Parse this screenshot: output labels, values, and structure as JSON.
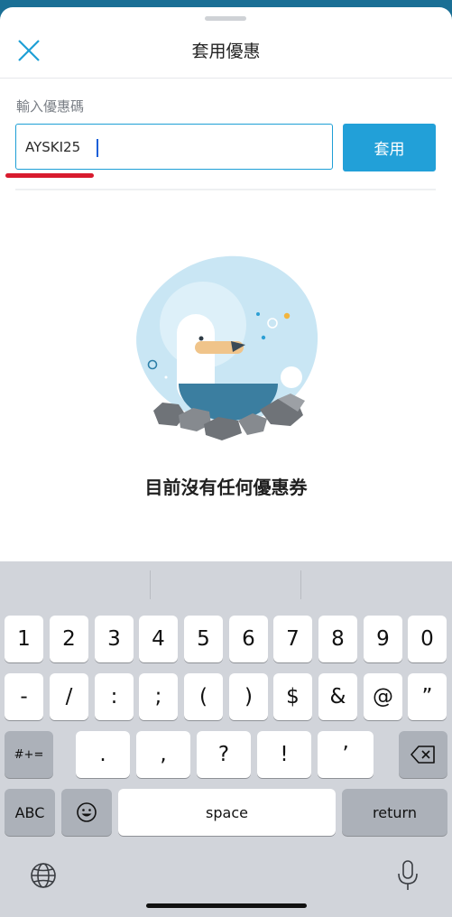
{
  "header": {
    "title": "套用優惠"
  },
  "coupon": {
    "label": "輸入優惠碼",
    "value": "AYSKI25",
    "apply_label": "套用"
  },
  "empty_state": {
    "message": "目前沒有任何優惠券"
  },
  "keyboard": {
    "row1": [
      "1",
      "2",
      "3",
      "4",
      "5",
      "6",
      "7",
      "8",
      "9",
      "0"
    ],
    "row2": [
      "-",
      "/",
      ":",
      ";",
      "(",
      ")",
      "$",
      "&",
      "@",
      "”"
    ],
    "row3_left": "#+=",
    "row3": [
      ".",
      ",",
      "?",
      "!",
      "’"
    ],
    "abc": "ABC",
    "space": "space",
    "return": "return"
  },
  "colors": {
    "accent": "#22a0d8",
    "highlight": "#d81b2e",
    "keyboard_bg": "#d1d4da"
  },
  "icons": {
    "close": "close-icon",
    "emoji": "emoji-icon",
    "delete": "backspace-icon",
    "globe": "globe-icon",
    "mic": "microphone-icon"
  }
}
